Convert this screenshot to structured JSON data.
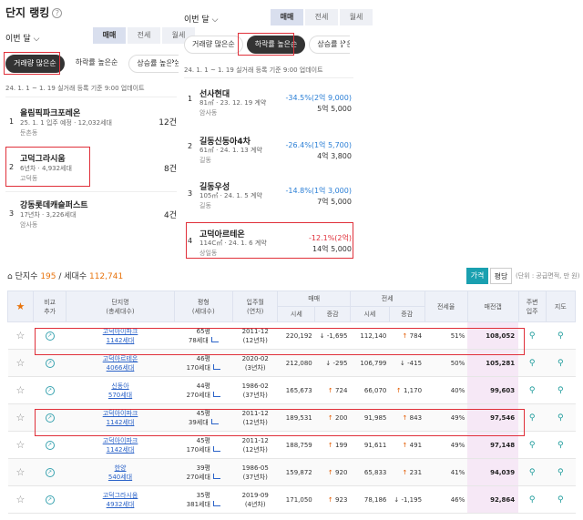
{
  "left": {
    "title": "단지 랭킹",
    "help": "?",
    "month": "이번 달",
    "seg": [
      "매매",
      "전세",
      "월세"
    ],
    "pills": [
      "거래량 많은순",
      "하락률 높은순",
      "상승률 높은순"
    ],
    "note": "24. 1. 1 ~ 1. 19 실거래 등록 기준 9:00 업데이트",
    "items": [
      {
        "no": "1",
        "name": "올림픽파크포레온",
        "sub": "25. 1. 1 입주 예정 · 12,032세대",
        "loc": "둔촌동",
        "count": "12건"
      },
      {
        "no": "2",
        "name": "고덕그라시움",
        "sub": "6년차 · 4,932세대",
        "loc": "고덕동",
        "count": "8건"
      },
      {
        "no": "3",
        "name": "강동롯데캐슬퍼스트",
        "sub": "17년차 · 3,226세대",
        "loc": "암사동",
        "count": "4건"
      }
    ]
  },
  "right": {
    "month": "이번 달",
    "seg": [
      "매매",
      "전세",
      "월세"
    ],
    "pills": [
      "거래량 많은순",
      "하락률 높은순",
      "상승률 높은순"
    ],
    "note": "24. 1. 1 ~ 1. 19 실거래 등록 기준 9:00 업데이트",
    "items": [
      {
        "no": "1",
        "name": "선사현대",
        "sub": "81㎡ · 23. 12. 19 계약",
        "loc": "암사동",
        "pct": "-34.5%(2억 9,000)",
        "price": "5억 5,000"
      },
      {
        "no": "2",
        "name": "길동신동아4차",
        "sub": "61㎡ · 24. 1. 13 계약",
        "loc": "길동",
        "pct": "-26.4%(1억 5,700)",
        "price": "4억 3,800"
      },
      {
        "no": "3",
        "name": "길동우성",
        "sub": "105㎡ · 24. 1. 5 계약",
        "loc": "길동",
        "pct": "-14.8%(1억 3,000)",
        "price": "7억 5,000"
      },
      {
        "no": "4",
        "name": "고덕아르테온",
        "sub": "114C㎡ · 24. 1. 6 계약",
        "loc": "상일동",
        "pct": "-12.1%(2억)",
        "price": "14억 5,000"
      }
    ]
  },
  "bottom": {
    "label_count": "단지수",
    "count": "195",
    "label_hh": "/ 세대수",
    "hh": "112,741",
    "btn_price": "가격",
    "btn_pyeong": "평당",
    "unit": "(단위 : 공급면적, 만 원)",
    "headers": {
      "compare": "비교\n추가",
      "name": "단지명\n(총세대수)",
      "area": "평형\n(세대수)",
      "year": "입주월\n(연차)",
      "sale": "매매",
      "jeonse": "전세",
      "ratio": "전세율",
      "gap": "매전갭",
      "near": "주변\n입주",
      "map": "지도",
      "price": "시세",
      "chg": "증감"
    },
    "rows": [
      {
        "name": "고덕아이파크",
        "hh": "1142세대",
        "py": "65평",
        "pyhh": "78세대",
        "ym": "2011-12",
        "age": "(12년차)",
        "sale": "220,192",
        "sd": "dn",
        "sc": "-1,695",
        "jeon": "112,140",
        "jd": "up",
        "jc": "784",
        "ratio": "51%",
        "gap": "108,052"
      },
      {
        "name": "고덕아르테온",
        "hh": "4066세대",
        "py": "46평",
        "pyhh": "170세대",
        "ym": "2020-02",
        "age": "(3년차)",
        "sale": "212,080",
        "sd": "dn",
        "sc": "-295",
        "jeon": "106,799",
        "jd": "dn",
        "jc": "-415",
        "ratio": "50%",
        "gap": "105,281"
      },
      {
        "name": "신동아",
        "hh": "570세대",
        "py": "44평",
        "pyhh": "270세대",
        "ym": "1986-02",
        "age": "(37년차)",
        "sale": "165,673",
        "sd": "up",
        "sc": "724",
        "jeon": "66,070",
        "jd": "up",
        "jc": "1,170",
        "ratio": "40%",
        "gap": "99,603"
      },
      {
        "name": "고덕아이파크",
        "hh": "1142세대",
        "py": "45평",
        "pyhh": "39세대",
        "ym": "2011-12",
        "age": "(12년차)",
        "sale": "189,531",
        "sd": "up",
        "sc": "200",
        "jeon": "91,985",
        "jd": "up",
        "jc": "843",
        "ratio": "49%",
        "gap": "97,546"
      },
      {
        "name": "고덕아이파크",
        "hh": "1142세대",
        "py": "45평",
        "pyhh": "170세대",
        "ym": "2011-12",
        "age": "(12년차)",
        "sale": "188,759",
        "sd": "up",
        "sc": "199",
        "jeon": "91,611",
        "jd": "up",
        "jc": "491",
        "ratio": "49%",
        "gap": "97,148"
      },
      {
        "name": "한양",
        "hh": "540세대",
        "py": "39평",
        "pyhh": "270세대",
        "ym": "1986-05",
        "age": "(37년차)",
        "sale": "159,872",
        "sd": "up",
        "sc": "920",
        "jeon": "65,833",
        "jd": "up",
        "jc": "231",
        "ratio": "41%",
        "gap": "94,039"
      },
      {
        "name": "고덕그라시움",
        "hh": "4932세대",
        "py": "35평",
        "pyhh": "381세대",
        "ym": "2019-09",
        "age": "(4년차)",
        "sale": "171,050",
        "sd": "up",
        "sc": "923",
        "jeon": "78,186",
        "jd": "dn",
        "jc": "-1,195",
        "ratio": "46%",
        "gap": "92,864"
      }
    ]
  },
  "colors": {
    "accent": "#e0303a",
    "teal": "#1aa0b0",
    "orange": "#e8730c",
    "blue": "#2b7fd6"
  }
}
